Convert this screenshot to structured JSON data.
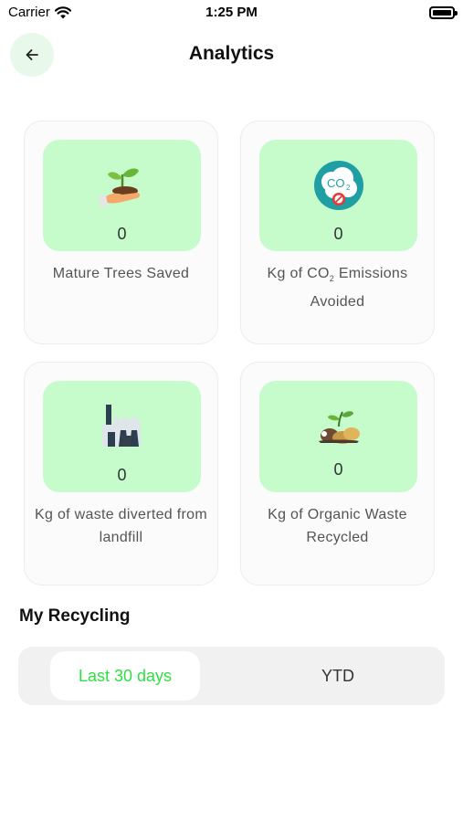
{
  "status_bar": {
    "carrier": "Carrier",
    "time": "1:25 PM"
  },
  "header": {
    "title": "Analytics",
    "back_icon": "arrow-left-icon"
  },
  "cards": [
    {
      "icon": "plant-in-hand-icon",
      "value": "0",
      "label": "Mature Trees Saved"
    },
    {
      "icon": "co2-blocked-icon",
      "value": "0",
      "label_prefix": "Kg of CO",
      "label_sub": "2",
      "label_suffix": " Emissions Avoided"
    },
    {
      "icon": "factory-icon",
      "value": "0",
      "label": "Kg of waste diverted from landfill"
    },
    {
      "icon": "organic-waste-icon",
      "value": "0",
      "label": "Kg of Organic Waste Recycled"
    }
  ],
  "recycling": {
    "title": "My Recycling",
    "tabs": [
      {
        "label": "Last 30 days",
        "active": true
      },
      {
        "label": "YTD",
        "active": false
      }
    ]
  },
  "colors": {
    "accent": "#2ee042",
    "card_fill": "#c6fbcb",
    "back_button_bg": "#e8f9ec"
  }
}
